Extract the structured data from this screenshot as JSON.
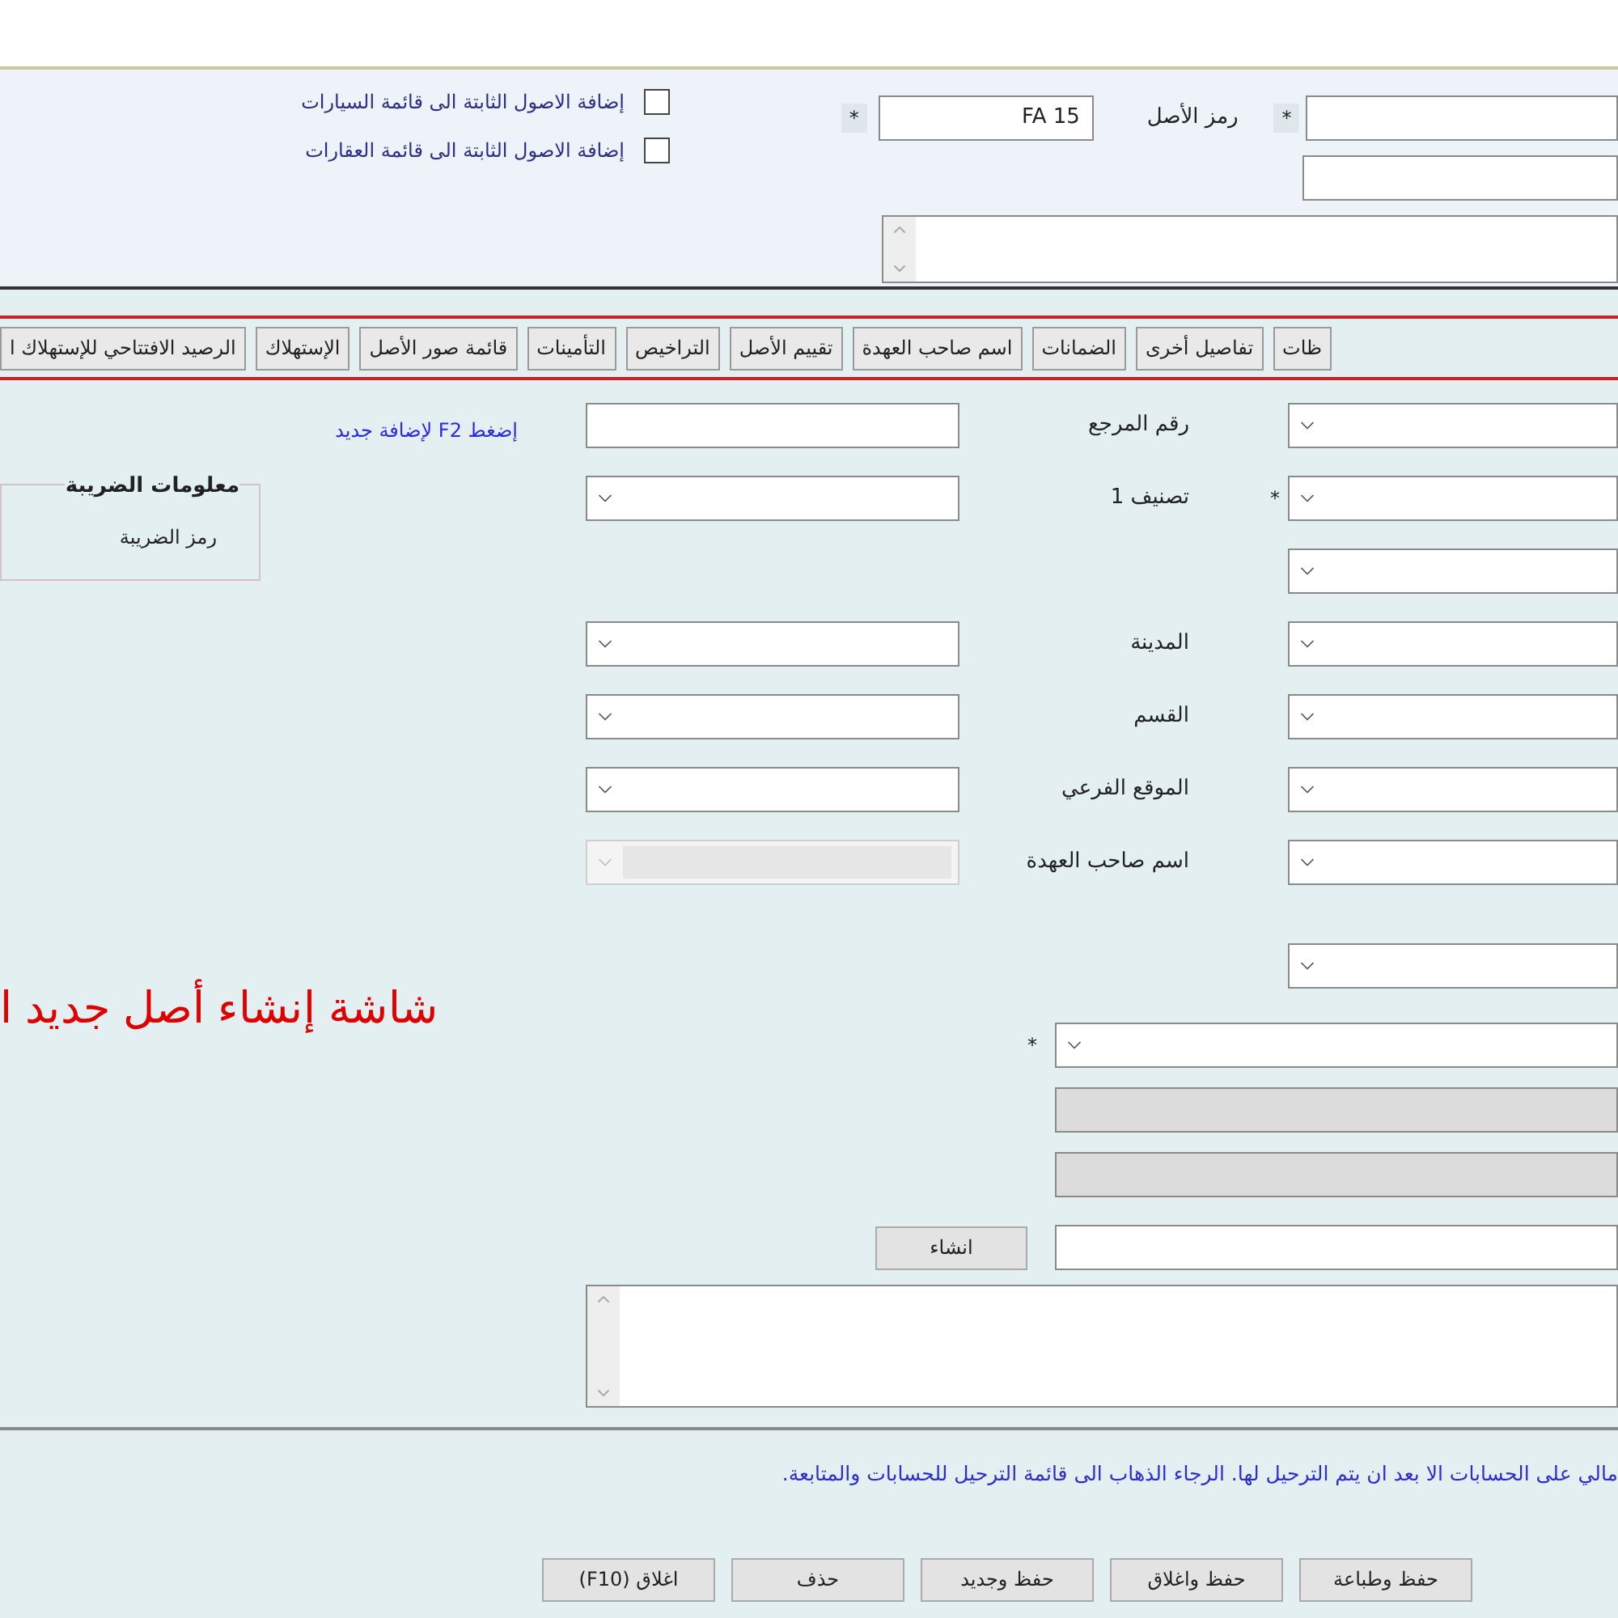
{
  "header": {
    "code_marker": "*",
    "code_label": "رمز الأصل",
    "code_value": "FA 15",
    "value_marker": "*",
    "checkboxes": [
      {
        "label": "إضافة الاصول الثابتة الى قائمة السيارات",
        "checked": false
      },
      {
        "label": "إضافة الاصول الثابتة الى قائمة العقارات",
        "checked": false
      }
    ]
  },
  "tabs": [
    {
      "label": "ظات",
      "selected": false
    },
    {
      "label": "تفاصيل أخرى",
      "selected": false
    },
    {
      "label": "الضمانات",
      "selected": false
    },
    {
      "label": "اسم صاحب العهدة",
      "selected": false
    },
    {
      "label": "تقييم الأصل",
      "selected": false
    },
    {
      "label": "التراخيص",
      "selected": false
    },
    {
      "label": "التأمينات",
      "selected": false
    },
    {
      "label": "قائمة صور الأصل",
      "selected": false
    },
    {
      "label": "الإستهلاك",
      "selected": false
    },
    {
      "label": "الرصيد الافتتاحي للإستهلاك ا",
      "selected": false
    }
  ],
  "add_new_link": "إضغط F2 لإضافة جديد",
  "tax": {
    "title": "معلومات الضريبة",
    "label": "رمز الضريبة"
  },
  "banner": "شاشة إنشاء أصل جديد ا",
  "rows": [
    {
      "middle": {
        "kind": "text"
      },
      "label": "رقم المرجع",
      "right": {
        "kind": "select"
      }
    },
    {
      "middle": {
        "kind": "select"
      },
      "label": "تصنيف 1",
      "marker": "*",
      "right": {
        "kind": "select"
      }
    },
    {
      "right": {
        "kind": "select"
      }
    },
    {
      "middle": {
        "kind": "select"
      },
      "label": "المدينة",
      "right": {
        "kind": "select"
      }
    },
    {
      "middle": {
        "kind": "select"
      },
      "label": "القسم",
      "right": {
        "kind": "select"
      }
    },
    {
      "middle": {
        "kind": "select"
      },
      "label": "الموقع الفرعي",
      "right": {
        "kind": "select"
      }
    },
    {
      "middle": {
        "kind": "disabled-select"
      },
      "label": "اسم صاحب العهدة",
      "right": {
        "kind": "select"
      }
    },
    {
      "right": {
        "kind": "select"
      }
    }
  ],
  "wide_rows": [
    {
      "kind": "select",
      "marker": "*"
    },
    {
      "kind": "disabled"
    },
    {
      "kind": "disabled"
    },
    {
      "kind": "text",
      "button": "انشاء"
    }
  ],
  "message": "مالي على الحسابات الا بعد ان يتم الترحيل لها. الرجاء الذهاب الى قائمة الترحيل للحسابات والمتابعة.",
  "buttons": [
    "حفظ وطباعة",
    "حفظ واغلاق",
    "حفظ وجديد",
    "حذف",
    "اغلاق (F10)"
  ]
}
